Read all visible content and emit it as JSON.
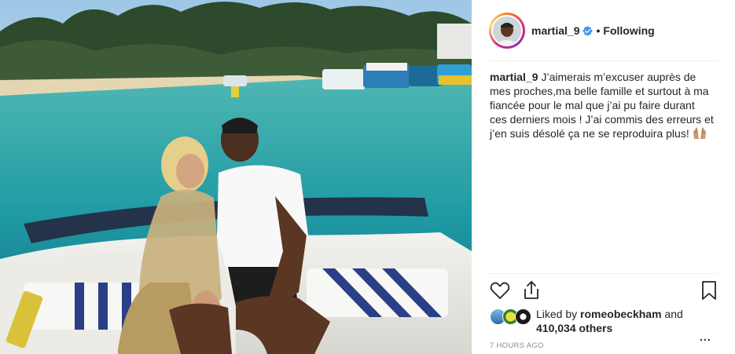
{
  "post": {
    "username": "martial_9",
    "separator": "•",
    "follow_state": "Following",
    "caption": "J’aimerais m’excuser auprès de mes proches,ma belle famille et surtout à ma fiancée pour le mal que j’ai pu faire durant ces derniers mois ! J’ai commis des erreurs et j’en suis désolé ça ne se reproduira plus!",
    "caption_emoji": "raised-hands-emoji",
    "likes": {
      "prefix": "Liked by ",
      "user": "romeobeckham",
      "and": " and",
      "count": "410,034 others"
    },
    "timestamp": "7 HOURS AGO",
    "more": "..."
  },
  "icons": {
    "verified": "verified-badge-icon",
    "like": "heart-outline-icon",
    "share": "share-icon",
    "save": "bookmark-icon",
    "more": "more-options-icon"
  },
  "colors": {
    "verified": "#3897f0",
    "muted": "#8e8e8e",
    "text": "#262626",
    "divider": "#efefef"
  }
}
